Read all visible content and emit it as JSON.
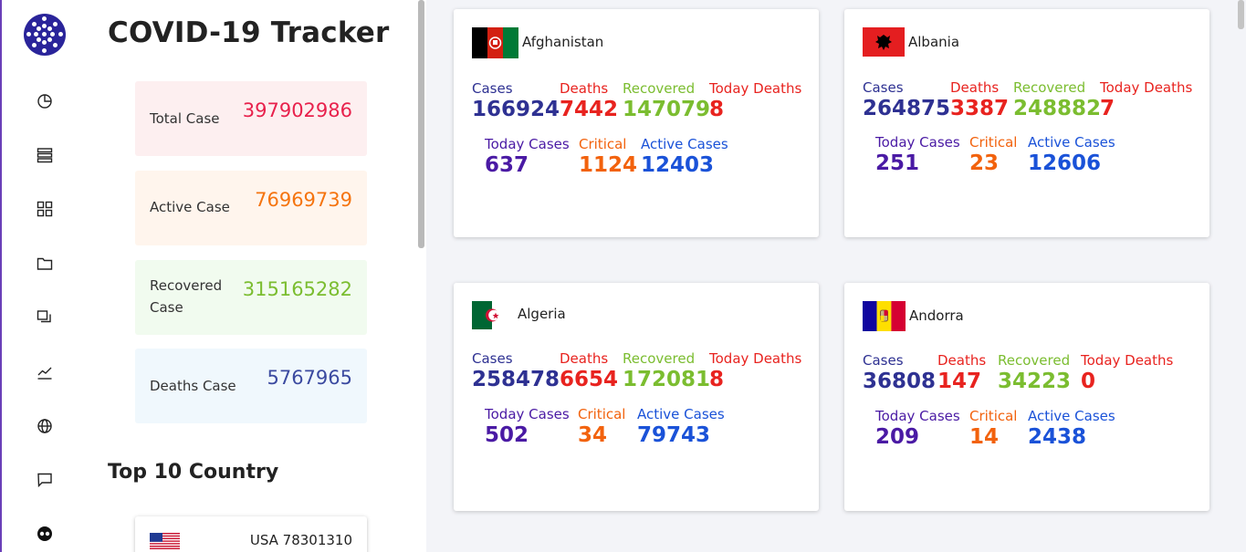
{
  "app": {
    "title": "COVID-19 Tracker"
  },
  "nav": [
    {
      "icon": "pie-chart-icon"
    },
    {
      "icon": "list-icon"
    },
    {
      "icon": "grid-icon"
    },
    {
      "icon": "folder-icon"
    },
    {
      "icon": "copy-icon"
    },
    {
      "icon": "trend-icon"
    },
    {
      "icon": "globe-icon"
    },
    {
      "icon": "chat-icon"
    },
    {
      "icon": "eyes-icon"
    }
  ],
  "stats": {
    "total": {
      "label": "Total Case",
      "value": "397902986",
      "color": "#e8214c",
      "bg": "#fdeff0"
    },
    "active": {
      "label": "Active Case",
      "value": "76969739",
      "color": "#f5740f",
      "bg": "#fff5ed"
    },
    "recovered": {
      "label_line1": "Recovered",
      "label_line2": "Case",
      "value": "315165282",
      "color": "#7bbd30",
      "bg": "#f1fbef"
    },
    "deaths": {
      "label": "Deaths Case",
      "value": "5767965",
      "color": "#3b4aa0",
      "bg": "#f0f8fd"
    }
  },
  "top10": {
    "title": "Top 10 Country",
    "items": [
      {
        "country": "USA",
        "value": "78301310",
        "text": "USA 78301310"
      }
    ]
  },
  "labels": {
    "cases": "Cases",
    "deaths": "Deaths",
    "recovered": "Recovered",
    "today_deaths": "Today Deaths",
    "today_cases": "Today Cases",
    "critical": "Critical",
    "active": "Active Cases"
  },
  "countries": [
    {
      "name": "Afghanistan",
      "cases": "166924",
      "deaths": "7442",
      "recovered": "147079",
      "today_deaths": "8",
      "today_cases": "637",
      "critical": "1124",
      "active": "12403"
    },
    {
      "name": "Albania",
      "cases": "264875",
      "deaths": "3387",
      "recovered": "248882",
      "today_deaths": "7",
      "today_cases": "251",
      "critical": "23",
      "active": "12606"
    },
    {
      "name": "Algeria",
      "cases": "258478",
      "deaths": "6654",
      "recovered": "172081",
      "today_deaths": "8",
      "today_cases": "502",
      "critical": "34",
      "active": "79743"
    },
    {
      "name": "Andorra",
      "cases": "36808",
      "deaths": "147",
      "recovered": "34223",
      "today_deaths": "0",
      "today_cases": "209",
      "critical": "14",
      "active": "2438"
    }
  ]
}
